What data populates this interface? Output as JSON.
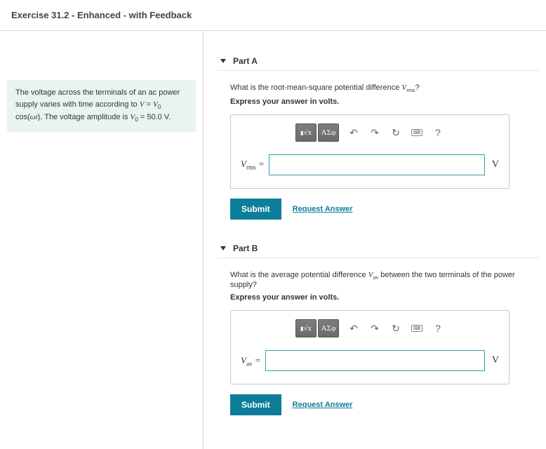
{
  "header": {
    "title": "Exercise 31.2 - Enhanced - with Feedback"
  },
  "info": {
    "line1_a": "The voltage across the terminals of an ac power supply varies with time according to ",
    "line1_eq_lhs": "V",
    "line1_eq_eq": " = ",
    "line1_eq_v0": "V",
    "line1_eq_v0sub": "0",
    "line1_eq_cos": " cos(",
    "line1_eq_omega": "ω",
    "line1_eq_t": "t",
    "line1_eq_close": ").",
    "line2_a": "The voltage amplitude is ",
    "line2_v0": "V",
    "line2_v0sub": "0",
    "line2_b": " = 50.0 V."
  },
  "toolbar": {
    "templates_label": "√x",
    "greek_label": "ΑΣφ",
    "undo": "↶",
    "redo": "↷",
    "reset": "↻",
    "keyboard": "⌨",
    "help": "?"
  },
  "partA": {
    "title": "Part A",
    "question_a": "What is the root-mean-square potential difference ",
    "question_var": "V",
    "question_sub": "rms",
    "question_b": "?",
    "instruct": "Express your answer in volts.",
    "var": "V",
    "var_sub": "rms",
    "eq": " =",
    "unit": "V",
    "submit": "Submit",
    "request": "Request Answer"
  },
  "partB": {
    "title": "Part B",
    "question_a": "What is the average potential difference ",
    "question_var": "V",
    "question_sub": "av",
    "question_b": " between the two terminals of the power supply?",
    "instruct": "Express your answer in volts.",
    "var": "V",
    "var_sub": "av",
    "eq": " =",
    "unit": "V",
    "submit": "Submit",
    "request": "Request Answer"
  }
}
